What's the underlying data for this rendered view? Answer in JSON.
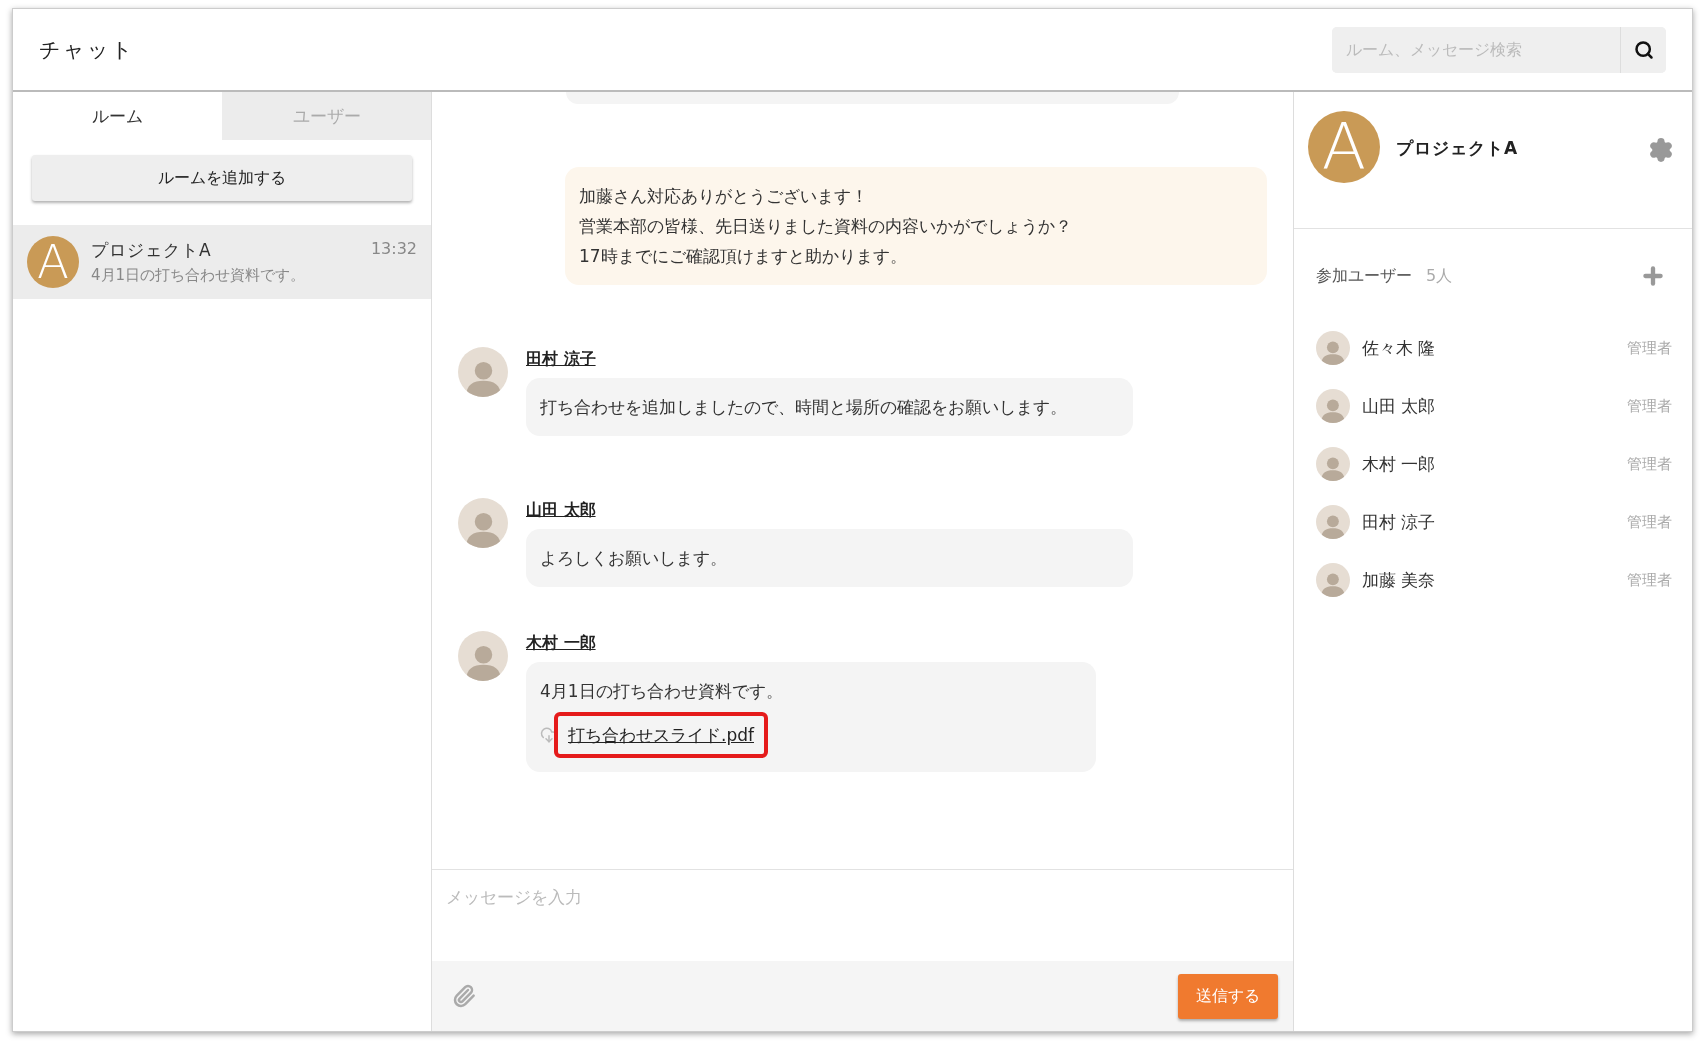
{
  "header": {
    "title": "チャット",
    "search": {
      "placeholder": "ルーム、メッセージ検索"
    }
  },
  "sidebar": {
    "tabs": [
      {
        "label": "ルーム",
        "selected": true
      },
      {
        "label": "ユーザー",
        "selected": false
      }
    ],
    "add_button": "ルームを追加する",
    "rooms": [
      {
        "avatar_letter": "A",
        "name": "プロジェクトA",
        "preview": "4月1日の打ち合わせ資料です。",
        "time": "13:32",
        "selected": true
      }
    ]
  },
  "chat": {
    "messages": [
      {
        "kind": "cut"
      },
      {
        "kind": "own",
        "lines": [
          "加藤さん対応ありがとうございます！",
          "営業本部の皆様、先日送りました資料の内容いかがでしょうか？",
          "17時までにご確認頂けますと助かります。"
        ]
      },
      {
        "kind": "other",
        "sender": "田村 涼子",
        "lines": [
          "打ち合わせを追加しましたので、時間と場所の確認をお願いします。"
        ]
      },
      {
        "kind": "other",
        "sender": "山田 太郎",
        "lines": [
          "よろしくお願いします。"
        ]
      },
      {
        "kind": "other",
        "sender": "木村 一郎",
        "lines": [
          "4月1日の打ち合わせ資料です。"
        ],
        "attachment": {
          "name": "打ち合わせスライド.pdf",
          "highlighted": true
        }
      }
    ],
    "input": {
      "placeholder": "メッセージを入力"
    },
    "send_button": "送信する"
  },
  "room_panel": {
    "avatar_letter": "A",
    "title": "プロジェクトA",
    "members_label": "参加ユーザー",
    "members_count": "5人",
    "members": [
      {
        "name": "佐々木 隆",
        "role": "管理者"
      },
      {
        "name": "山田 太郎",
        "role": "管理者"
      },
      {
        "name": "木村 一郎",
        "role": "管理者"
      },
      {
        "name": "田村 涼子",
        "role": "管理者"
      },
      {
        "name": "加藤 美奈",
        "role": "管理者"
      }
    ]
  }
}
